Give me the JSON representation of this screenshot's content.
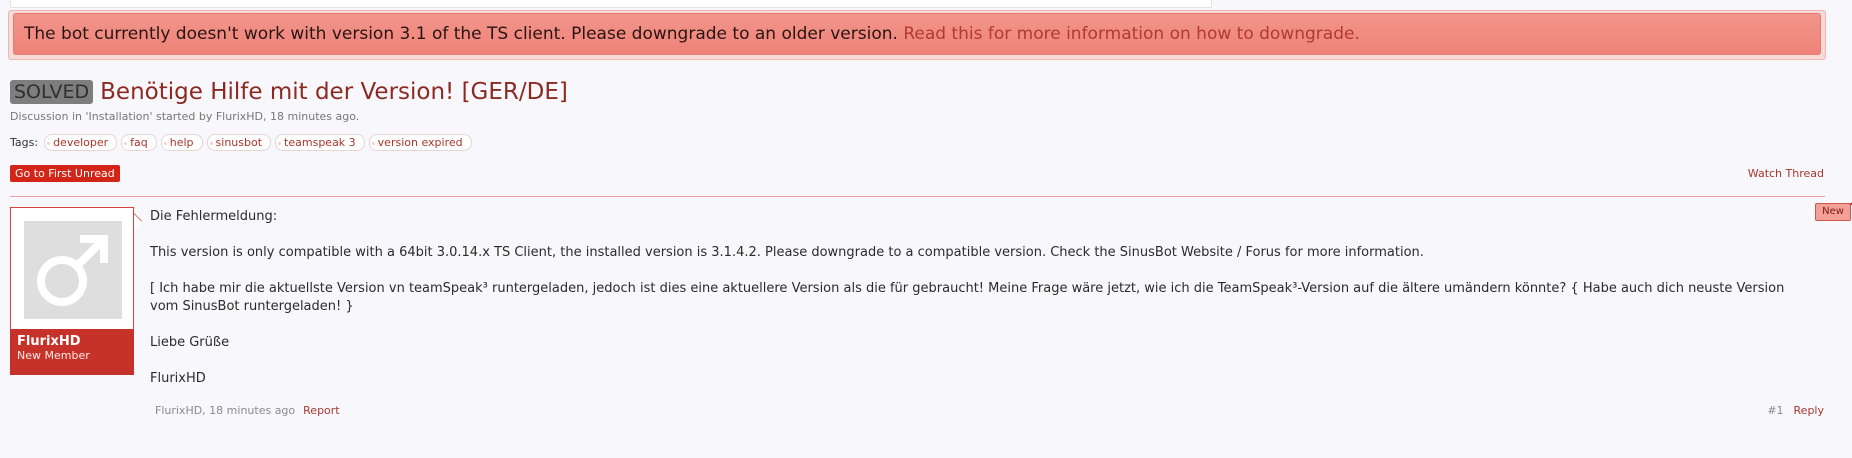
{
  "notice": {
    "text": "The bot currently doesn't work with version 3.1 of the TS client. Please downgrade to an older version. ",
    "link": "Read this for more information on how to downgrade."
  },
  "thread": {
    "prefix": "SOLVED",
    "title": "Benötige Hilfe mit der Version! [GER/DE]",
    "meta": "Discussion in 'Installation' started by FlurixHD, 18 minutes ago.",
    "tags_label": "Tags:",
    "tags": [
      "developer",
      "faq",
      "help",
      "sinusbot",
      "teamspeak 3",
      "version expired"
    ],
    "first_unread_label": "Go to First Unread",
    "watch_label": "Watch Thread"
  },
  "post": {
    "new_badge": "New",
    "username": "FlurixHD",
    "user_title": "New Member",
    "paragraphs": [
      "Die Fehlermeldung:",
      "This version is only compatible with a 64bit 3.0.14.x TS Client, the installed version is 3.1.4.2. Please downgrade to a compatible version. Check the SinusBot Website / Forus for more information.",
      "[ Ich habe mir die aktuellste Version vn teamSpeak³ runtergeladen, jedoch ist dies eine aktuellere Version als die für gebraucht! Meine Frage wäre jetzt, wie ich die TeamSpeak³-Version auf die ältere umändern könnte? { Habe auch dich neuste Version vom SinusBot runtergeladen! }",
      "Liebe Grüße",
      "FlurixHD"
    ],
    "footer_meta": "FlurixHD, 18 minutes ago",
    "report_label": "Report",
    "post_number": "#1",
    "reply_label": "Reply"
  },
  "colors": {
    "accent": "#a8352b",
    "notice_bg": "#ee8278",
    "button_red": "#d32418",
    "user_card": "#c6322a"
  },
  "icons": {
    "avatar": "male-symbol-icon"
  }
}
